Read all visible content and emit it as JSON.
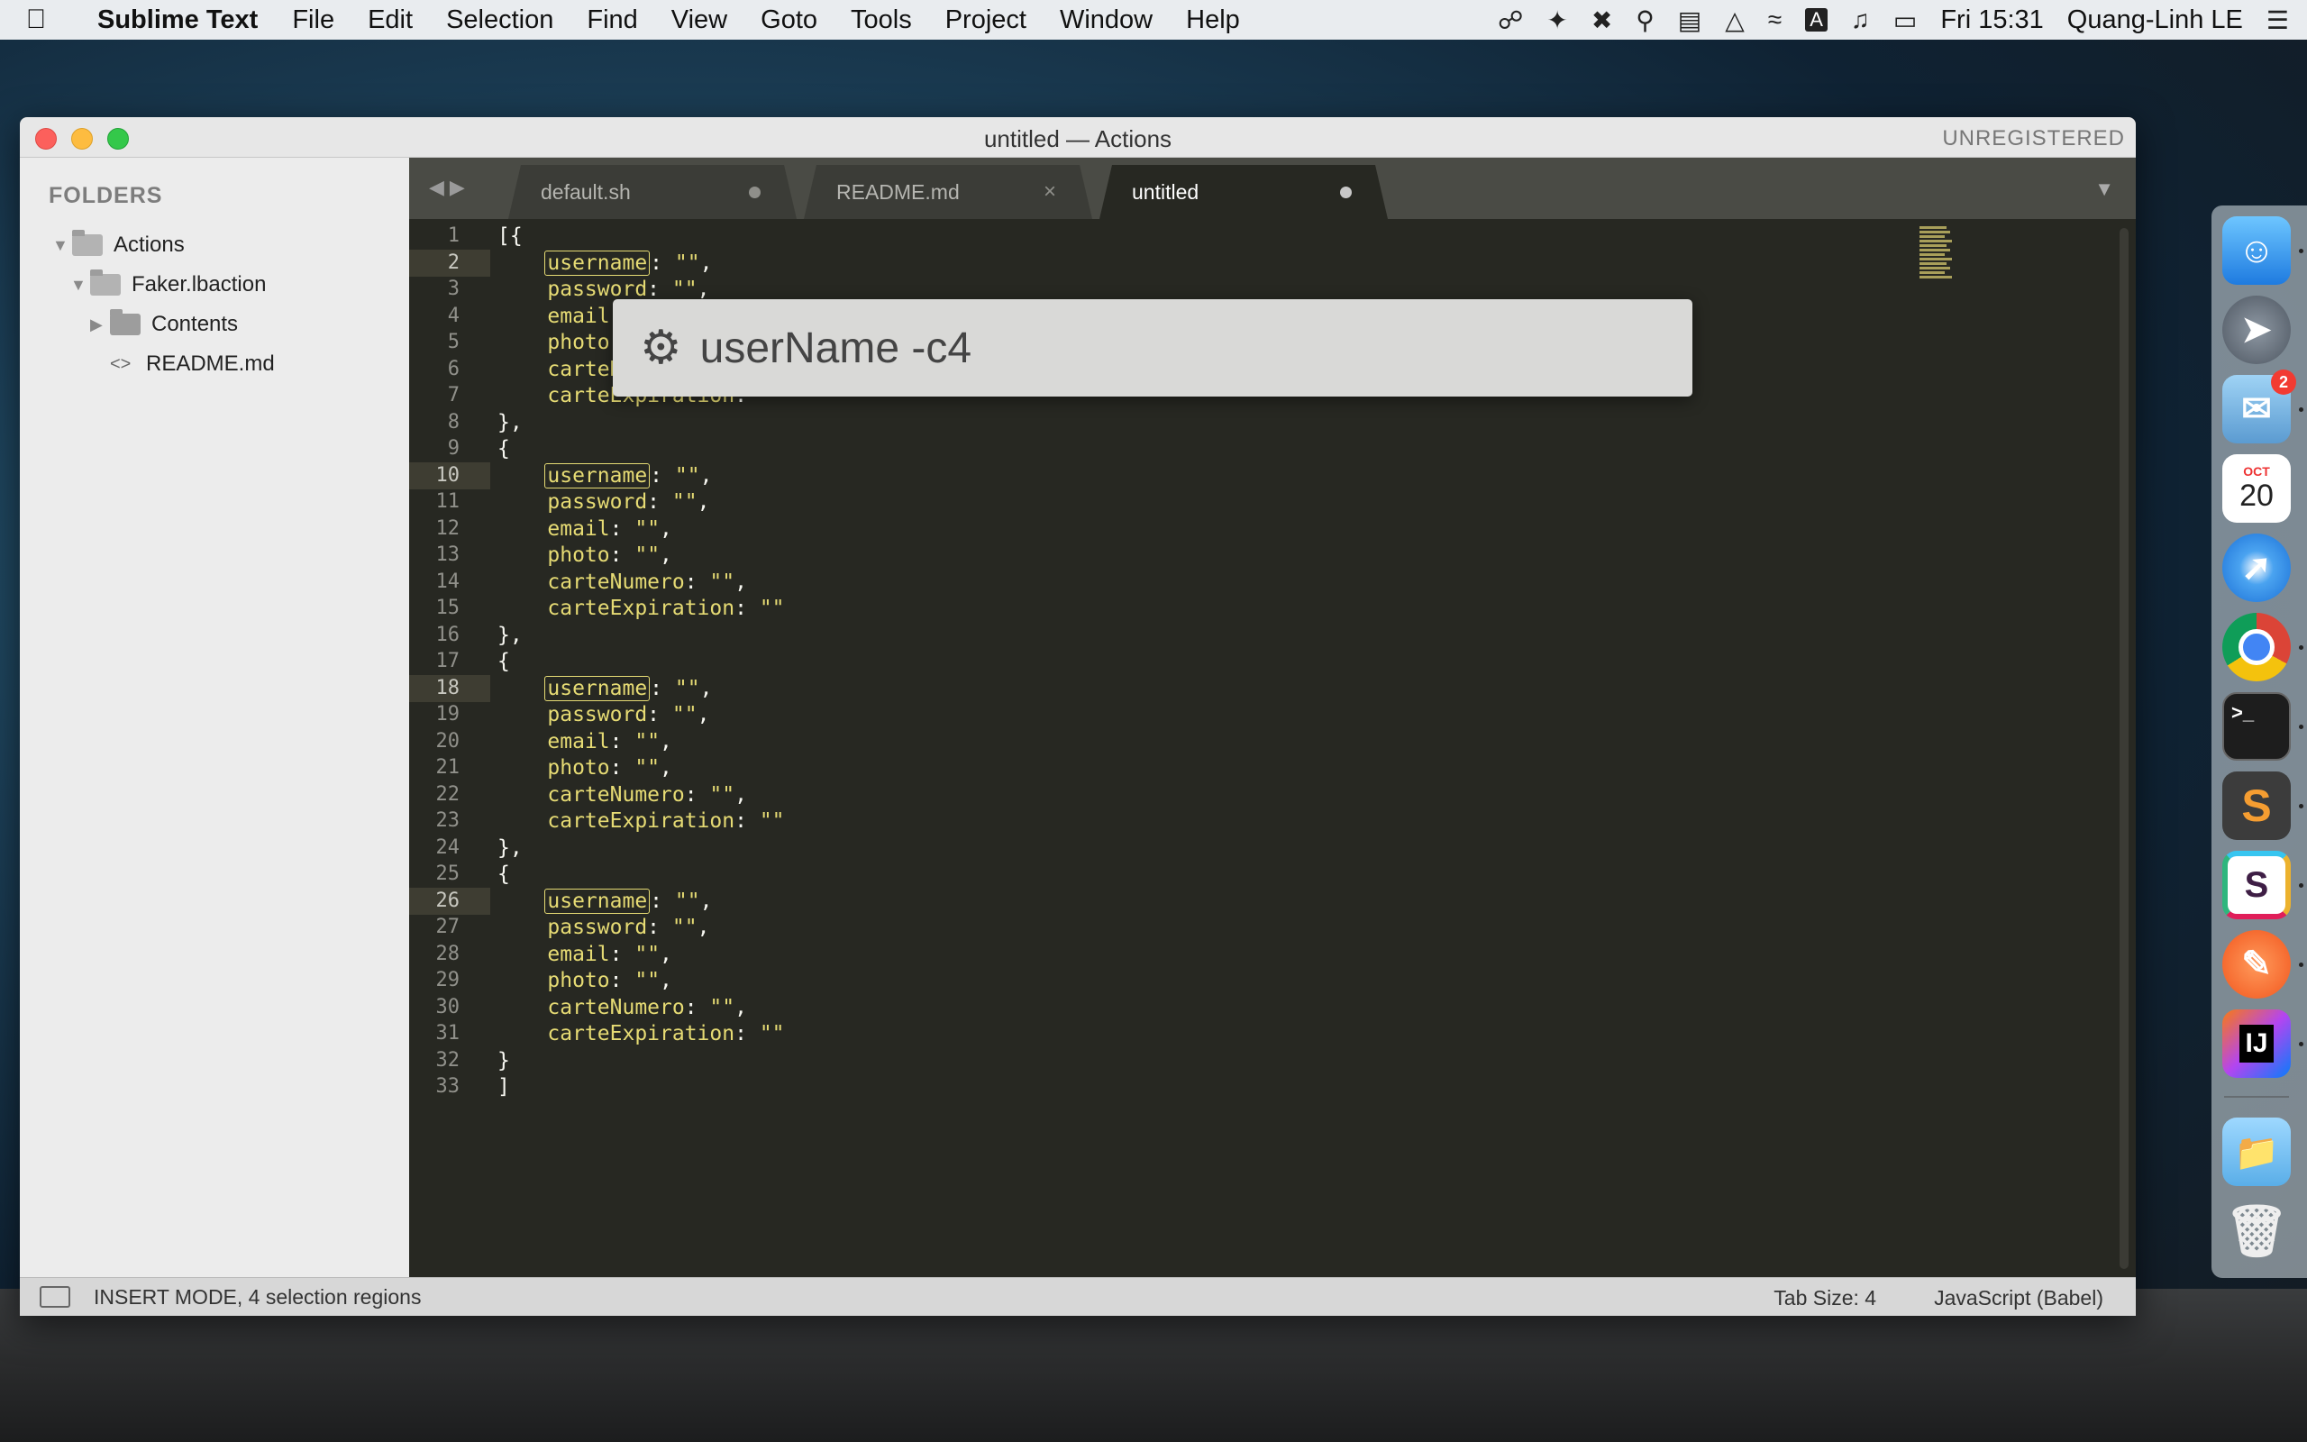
{
  "menubar": {
    "app_name": "Sublime Text",
    "items": [
      "File",
      "Edit",
      "Selection",
      "Find",
      "View",
      "Goto",
      "Tools",
      "Project",
      "Window",
      "Help"
    ],
    "clock": "Fri 15:31",
    "user": "Quang-Linh LE",
    "input_source": "A"
  },
  "window": {
    "title": "untitled — Actions",
    "registration": "UNREGISTERED"
  },
  "sidebar": {
    "title": "FOLDERS",
    "tree": [
      {
        "label": "Actions",
        "type": "folder-open",
        "depth": 0
      },
      {
        "label": "Faker.lbaction",
        "type": "folder-open",
        "depth": 1
      },
      {
        "label": "Contents",
        "type": "folder-closed",
        "depth": 2
      },
      {
        "label": "README.md",
        "type": "file",
        "depth": 2
      }
    ]
  },
  "tabs": [
    {
      "label": "default.sh",
      "state": "modified",
      "active": false
    },
    {
      "label": "README.md",
      "state": "close",
      "active": false
    },
    {
      "label": "untitled",
      "state": "modified",
      "active": true
    }
  ],
  "tab_close_glyph": "×",
  "editor": {
    "line_numbers": [
      "1",
      "2",
      "3",
      "4",
      "5",
      "6",
      "7",
      "8",
      "9",
      "10",
      "11",
      "12",
      "13",
      "14",
      "15",
      "16",
      "17",
      "18",
      "19",
      "20",
      "21",
      "22",
      "23",
      "24",
      "25",
      "26",
      "27",
      "28",
      "29",
      "30",
      "31",
      "32",
      "33"
    ],
    "highlighted_lines": [
      2,
      10,
      18,
      26
    ],
    "lines": [
      "[{",
      "    username: \"\",",
      "    password: \"\",",
      "    email: \"\",",
      "    photo: \"\",",
      "    carteNumero: \"\",",
      "    carteExpiration: \"\"",
      "},",
      "{",
      "    username: \"\",",
      "    password: \"\",",
      "    email: \"\",",
      "    photo: \"\",",
      "    carteNumero: \"\",",
      "    carteExpiration: \"\"",
      "},",
      "{",
      "    username: \"\",",
      "    password: \"\",",
      "    email: \"\",",
      "    photo: \"\",",
      "    carteNumero: \"\",",
      "    carteExpiration: \"\"",
      "},",
      "{",
      "    username: \"\",",
      "    password: \"\",",
      "    email: \"\",",
      "    photo: \"\",",
      "    carteNumero: \"\",",
      "    carteExpiration: \"\"",
      "}",
      "]"
    ]
  },
  "popup": {
    "icon": "gear-icon",
    "text": "userName -c4"
  },
  "status": {
    "mode": "INSERT MODE, 4 selection regions",
    "tab_size": "Tab Size: 4",
    "syntax": "JavaScript (Babel)"
  },
  "dock": {
    "mail_badge": "2",
    "calendar_month": "OCT",
    "calendar_day": "20",
    "terminal_prompt": ">_",
    "sublime_letter": "S",
    "slack_letter": "S",
    "intellij_letter": "IJ"
  },
  "colors": {
    "editor_bg": "#272822",
    "string_yellow": "#e6db74",
    "selection_border": "#e6db74"
  }
}
